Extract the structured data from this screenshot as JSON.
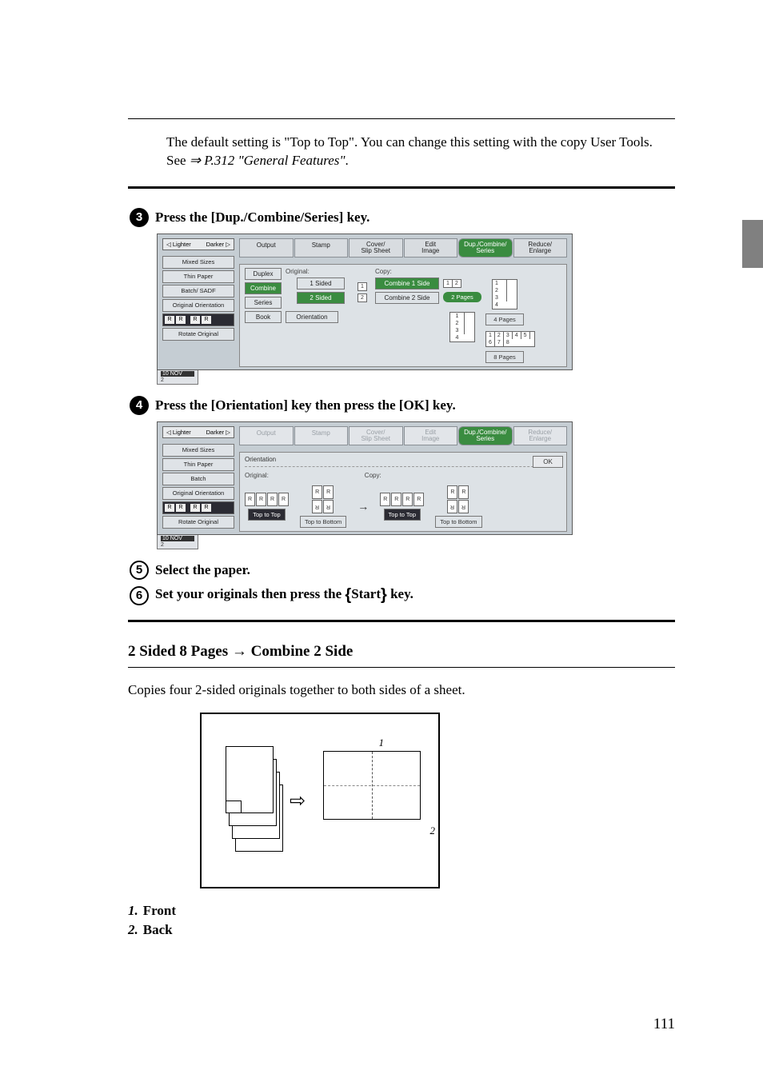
{
  "intro": {
    "text1": "The default setting is \"Top to Top\". You can change this setting with the copy User Tools. See ",
    "ref": "⇒ P.312 \"General Features\"",
    "period": "."
  },
  "steps": {
    "s3": {
      "prefix": "Press the ",
      "key1": "[Dup./Combine/Series]",
      "suffix": " key."
    },
    "s4": {
      "prefix": "Press the ",
      "key1": "[Orientation]",
      "mid": " key then press the ",
      "key2": "[OK]",
      "suffix": " key."
    },
    "s5": "Select the paper.",
    "s6": {
      "prefix": "Set your originals then press the ",
      "keyglyph_open": "{",
      "keyname": "Start",
      "keyglyph_close": "}",
      "suffix": " key."
    }
  },
  "screenshot": {
    "tabs": [
      "Output",
      "Stamp",
      "Cover/\nSlip Sheet",
      "Edit\nImage",
      "Dup./Combine/\nSeries",
      "Reduce/\nEnlarge"
    ],
    "sidebar": {
      "lighter": "◁ Lighter",
      "darker": "Darker ▷",
      "items1": [
        "Mixed Sizes",
        "Thin Paper",
        "Batch/ SADF",
        "Original Orientation"
      ],
      "items2": [
        "Mixed Sizes",
        "Thin Paper",
        "Batch",
        "Original Orientation"
      ],
      "rotate": "Rotate Original"
    },
    "panel1": {
      "col1": [
        "Duplex",
        "Combine",
        "Series",
        "Book"
      ],
      "origLabel": "Original:",
      "origBtns": [
        "1 Sided",
        "2 Sided"
      ],
      "orientation": "Orientation",
      "copyLabel": "Copy:",
      "copyBtns": [
        "Combine 1 Side",
        "Combine 2 Side"
      ],
      "pages2": "2 Pages",
      "pages4": "4 Pages",
      "pages8": "8 Pages"
    },
    "panel2": {
      "orientation": "Orientation",
      "ok": "OK",
      "origLabel": "Original:",
      "copyLabel": "Copy:",
      "btns": [
        "Top to Top",
        "Top to Bottom",
        "Top to Top",
        "Top to Bottom"
      ]
    },
    "timestamp": {
      "line1": "10 NOV",
      "line2": "2"
    }
  },
  "section": {
    "heading": "2 Sided 8 Pages → Combine 2 Side",
    "desc": "Copies four 2-sided originals together to both sides of a sheet.",
    "labels": {
      "front": "1",
      "back": "2"
    }
  },
  "list": {
    "l1num": "1.",
    "l1": "Front",
    "l2num": "2.",
    "l2": "Back"
  },
  "pagenum": "111"
}
